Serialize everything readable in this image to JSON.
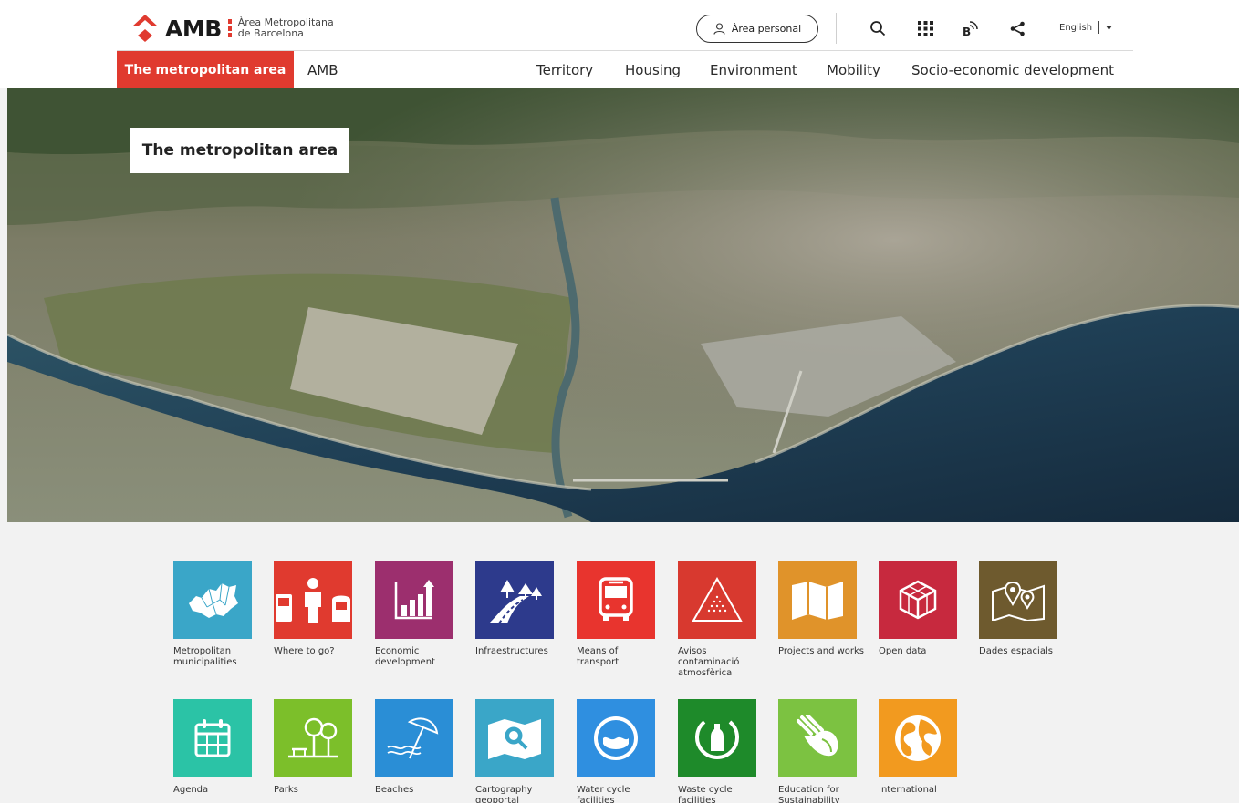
{
  "header": {
    "logo": {
      "word": "AMB",
      "sub_line1": "Àrea Metropolitana",
      "sub_line2": "de Barcelona",
      "icon": "amb-diamond-logo"
    },
    "area_personal_label": "Àrea personal",
    "icons": [
      "user-icon",
      "search-icon",
      "apps-grid-icon",
      "bicing-accessibility-icon",
      "share-icon"
    ],
    "language": "English",
    "nav_active": "The metropolitan area",
    "nav": [
      "AMB",
      "Territory",
      "Housing",
      "Environment",
      "Mobility",
      "Socio-economic development"
    ]
  },
  "hero": {
    "title": "The metropolitan area"
  },
  "tiles": [
    {
      "label": "Metropolitan municipalities",
      "color": "#3aa6c8",
      "icon": "map-municipalities-icon"
    },
    {
      "label": "Where to go?",
      "color": "#e03a2f",
      "icon": "pedestrian-transport-icon"
    },
    {
      "label": "Economic development",
      "color": "#9c2f6e",
      "icon": "bar-chart-icon"
    },
    {
      "label": "Infraestructures",
      "color": "#2d3a8c",
      "icon": "road-trees-icon"
    },
    {
      "label": "Means of transport",
      "color": "#e8342e",
      "icon": "bus-icon"
    },
    {
      "label": "Avisos contaminació atmosfèrica",
      "color": "#d8392f",
      "icon": "warning-triangle-icon"
    },
    {
      "label": "Projects and works",
      "color": "#e0932a",
      "icon": "folded-map-icon"
    },
    {
      "label": "Open data",
      "color": "#c7293e",
      "icon": "cube-data-icon"
    },
    {
      "label": "Dades espacials",
      "color": "#6e5a2e",
      "icon": "map-pin-icon"
    },
    {
      "label": "Agenda",
      "color": "#2bc3a6",
      "icon": "calendar-icon"
    },
    {
      "label": "Parks",
      "color": "#7cbf2a",
      "icon": "trees-bench-icon"
    },
    {
      "label": "Beaches",
      "color": "#2a8ed6",
      "icon": "beach-umbrella-icon"
    },
    {
      "label": "Cartography geoportal",
      "color": "#3aa6c8",
      "icon": "map-search-icon"
    },
    {
      "label": "Water cycle facilities",
      "color": "#2f8fe0",
      "icon": "water-cycle-icon"
    },
    {
      "label": "Waste cycle facilities",
      "color": "#1e8a2a",
      "icon": "bottle-cycle-icon"
    },
    {
      "label": "Education for Sustainability",
      "color": "#7cc241",
      "icon": "hands-leaf-icon"
    },
    {
      "label": "International",
      "color": "#f29a1f",
      "icon": "globe-icon"
    }
  ]
}
